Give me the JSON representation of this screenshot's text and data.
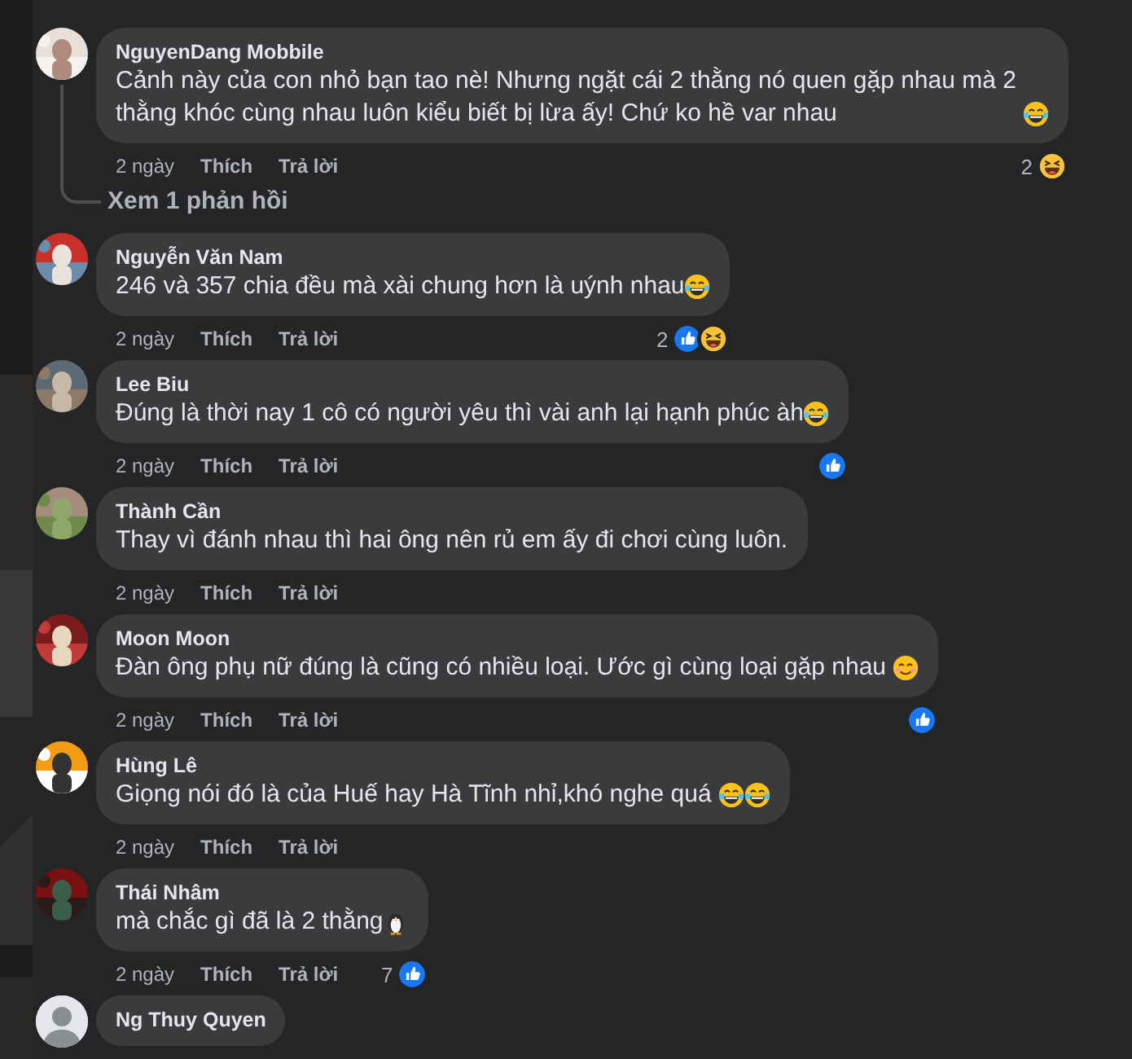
{
  "comments": [
    {
      "author": "NguyenDang Mobbile",
      "avatar": {
        "kind": "picture"
      },
      "text": "Cảnh này của con nhỏ bạn tao nè! Nhưng ngặt cái 2 thằng nó quen gặp nhau mà 2 thằng khóc cùng nhau luôn kiểu biết bị lừa ấy! Chứ ko hề var nhau",
      "emojis": [
        {
          "kind": "laugh"
        }
      ],
      "time": "2 ngày",
      "like": "Thích",
      "reply": "Trả lời",
      "reaction_count": "2",
      "reactions": [
        {
          "kind": "haha"
        }
      ],
      "replies_link": "Xem 1 phản hồi"
    },
    {
      "author": "Nguyễn Văn Nam",
      "avatar": {
        "kind": "picture"
      },
      "text": "246 và 357 chia đều mà xài chung hơn là uýnh nhau",
      "emojis": [
        {
          "kind": "laugh"
        }
      ],
      "time": "2 ngày",
      "like": "Thích",
      "reply": "Trả lời",
      "reaction_count": "2",
      "reactions": [
        {
          "kind": "like"
        },
        {
          "kind": "haha"
        }
      ]
    },
    {
      "author": "Lee Biu",
      "avatar": {
        "kind": "picture"
      },
      "text": "Đúng là thời nay 1 cô có người yêu thì vài anh lại hạnh phúc àh",
      "emojis": [
        {
          "kind": "laugh"
        }
      ],
      "time": "2 ngày",
      "like": "Thích",
      "reply": "Trả lời",
      "reactions": [
        {
          "kind": "like"
        }
      ]
    },
    {
      "author": "Thành Cần",
      "avatar": {
        "kind": "picture"
      },
      "text": "Thay vì đánh nhau thì hai ông nên rủ em ấy đi chơi cùng luôn.",
      "time": "2 ngày",
      "like": "Thích",
      "reply": "Trả lời"
    },
    {
      "author": "Moon Moon",
      "avatar": {
        "kind": "picture"
      },
      "text": "Đàn ông phụ nữ đúng là cũng có nhiều loại. Ước gì cùng loại gặp nhau ",
      "emojis": [
        {
          "kind": "smile"
        }
      ],
      "time": "2 ngày",
      "like": "Thích",
      "reply": "Trả lời",
      "reactions": [
        {
          "kind": "like"
        }
      ]
    },
    {
      "author": "Hùng Lê",
      "avatar": {
        "kind": "picture"
      },
      "text": "Giọng nói đó là của Huế hay Hà Tĩnh nhỉ,khó nghe quá ",
      "emojis": [
        {
          "kind": "laugh"
        },
        {
          "kind": "laugh"
        }
      ],
      "time": "2 ngày",
      "like": "Thích",
      "reply": "Trả lời"
    },
    {
      "author": "Thái Nhâm",
      "avatar": {
        "kind": "picture"
      },
      "text": "mà chắc gì đã là 2 thằng",
      "emojis": [
        {
          "kind": "penguin"
        }
      ],
      "time": "2 ngày",
      "like": "Thích",
      "reply": "Trả lời",
      "reaction_count": "7",
      "reactions": [
        {
          "kind": "like"
        }
      ]
    },
    {
      "author": "Ng Thuy Quyen",
      "avatar": {
        "kind": "default"
      }
    }
  ]
}
